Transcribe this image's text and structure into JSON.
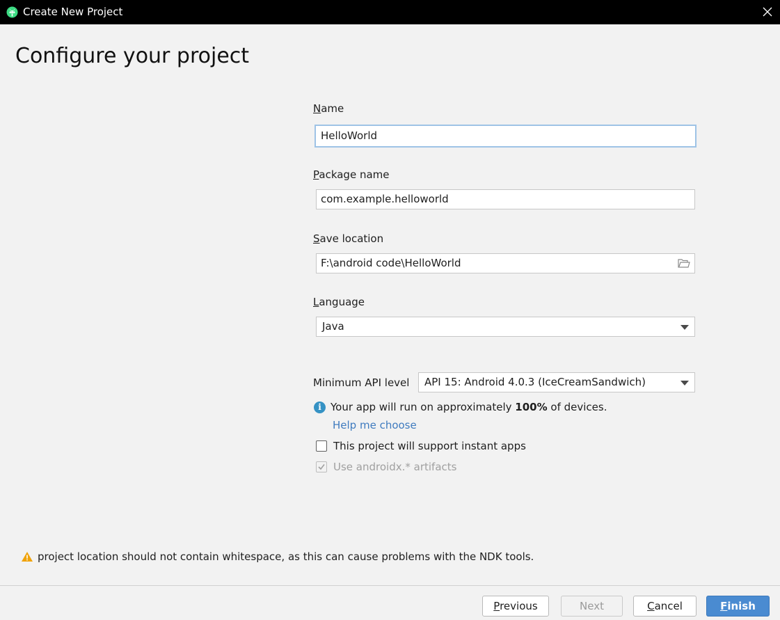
{
  "window": {
    "title": "Create New Project",
    "icon": "android-studio-icon",
    "close_icon": "close-icon"
  },
  "page": {
    "heading": "Configure your project"
  },
  "form": {
    "name": {
      "label_mnemonic": "N",
      "label_rest": "ame",
      "value": "HelloWorld"
    },
    "package": {
      "label_mnemonic": "P",
      "label_rest": "ackage name",
      "value": "com.example.helloworld"
    },
    "save_location": {
      "label_mnemonic": "S",
      "label_rest": "ave location",
      "value": "F:\\android code\\HelloWorld",
      "browse_icon": "folder-icon"
    },
    "language": {
      "label_mnemonic": "L",
      "label_rest": "anguage",
      "value": "Java"
    },
    "min_api": {
      "label": "Minimum API level",
      "value": "API 15: Android 4.0.3 (IceCreamSandwich)"
    },
    "info": {
      "text_before": "Your app will run on approximately ",
      "percent": "100%",
      "text_after": " of devices.",
      "help_link": "Help me choose"
    },
    "instant_apps": {
      "label": "This project will support instant apps",
      "checked": false
    },
    "androidx": {
      "label": "Use androidx.* artifacts",
      "checked": true,
      "disabled": true
    }
  },
  "warning": {
    "icon": "warning-icon",
    "text": "project location should not contain whitespace, as this can cause problems with the NDK tools."
  },
  "buttons": {
    "previous": {
      "mnemonic": "P",
      "rest": "revious"
    },
    "next": {
      "label": "Next"
    },
    "cancel": {
      "mnemonic": "C",
      "rest": "ancel"
    },
    "finish": {
      "mnemonic": "F",
      "rest": "inish"
    }
  },
  "colors": {
    "accent": "#4a8bd1",
    "link": "#3f7bbf",
    "info": "#3592c4",
    "warning": "#f0a30a",
    "android_green": "#3ddc84"
  }
}
